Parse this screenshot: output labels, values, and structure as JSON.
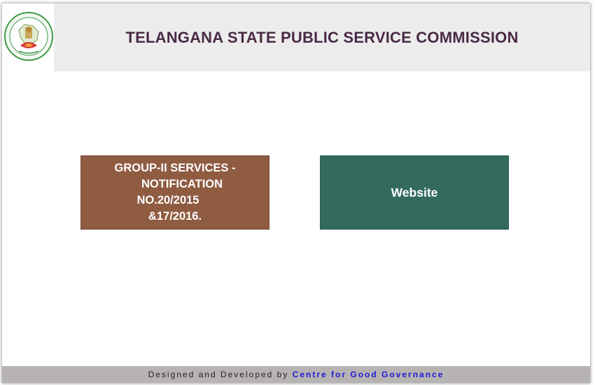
{
  "header": {
    "title": "TELANGANA STATE PUBLIC SERVICE COMMISSION",
    "logo_icon": "tspsc-emblem-icon"
  },
  "main": {
    "group_button": {
      "line1": "GROUP-II SERVICES -",
      "line2": "NOTIFICATION NO.20/2015",
      "line3": "&17/2016.",
      "color": "#8f5b41"
    },
    "website_button": {
      "label": "Website",
      "color": "#326b5e"
    }
  },
  "footer": {
    "prefix": "Designed and Developed by",
    "link": "Centre for Good Governance"
  },
  "colors": {
    "title": "#4a2a46",
    "header_bg": "#ececec",
    "footer_bg": "#b7b3b3",
    "link": "#1a1ad8"
  }
}
